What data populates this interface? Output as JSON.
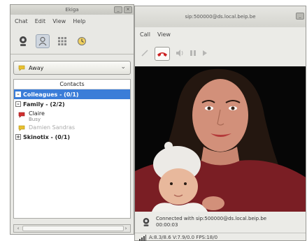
{
  "left_window": {
    "title": "Ekiga",
    "menu": [
      "Chat",
      "Edit",
      "View",
      "Help"
    ],
    "presence": "Away",
    "contacts_header": "Contacts",
    "groups": [
      {
        "label": "Colleagues - (0/1)",
        "selected": true,
        "expander": "–"
      },
      {
        "label": "Family - (2/2)",
        "selected": false,
        "expander": "–"
      },
      {
        "label": "Skinotix - (0/1)",
        "selected": false,
        "expander": "+"
      }
    ],
    "contacts": [
      {
        "name": "Claire",
        "status": "Busy"
      },
      {
        "name": "Damien Sandras",
        "status": ""
      }
    ]
  },
  "right_window": {
    "title": "sip:500000@ds.local.beip.be",
    "menu": [
      "Call",
      "View"
    ],
    "connection_status": "Connected with sip:500000@ds.local.beip.be",
    "call_duration": "00:00:03",
    "stats": "A:8.3/8.6 V:7.9/0.0 FPS:18/0"
  },
  "colors": {
    "selection": "#3b7dd8",
    "hangup_red": "#cc2222",
    "busy_red": "#d23030",
    "away_yellow": "#e8c030"
  }
}
